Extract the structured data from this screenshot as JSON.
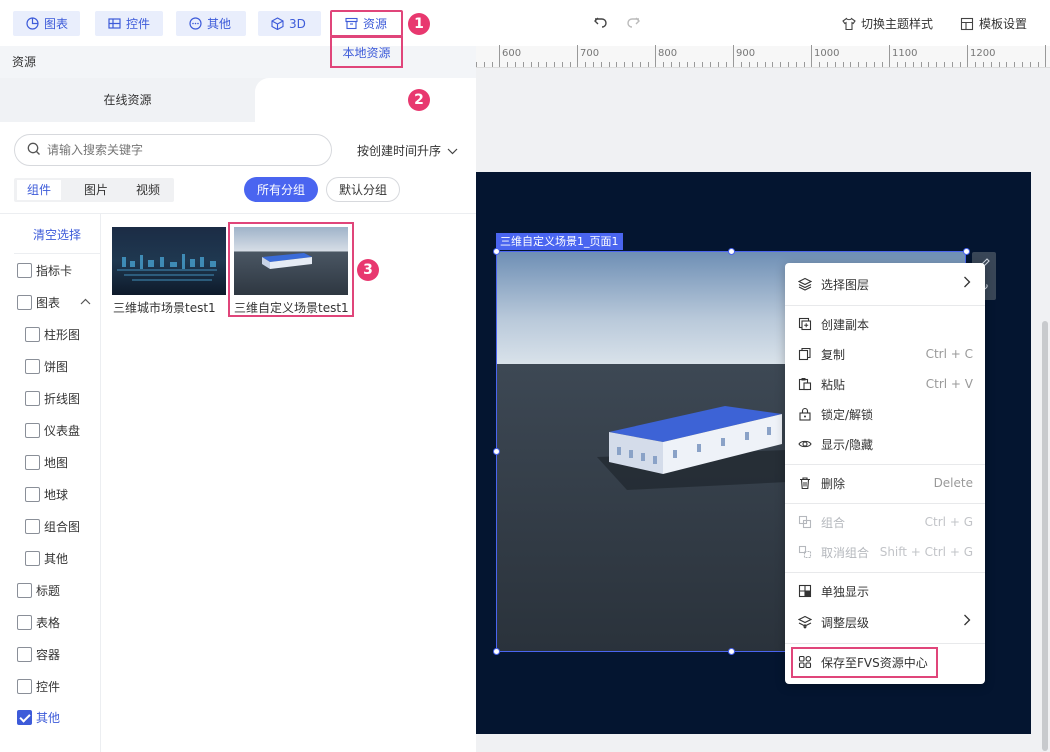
{
  "toolbar": {
    "buttons": [
      {
        "label": "图表",
        "icon": "chart-icon"
      },
      {
        "label": "控件",
        "icon": "widget-icon"
      },
      {
        "label": "其他",
        "icon": "more-icon"
      },
      {
        "label": "3D",
        "icon": "cube-icon"
      },
      {
        "label": "资源",
        "icon": "archive-icon"
      }
    ],
    "badges": [
      "1",
      "2",
      "3"
    ],
    "theme_label": "切换主题样式",
    "template_label": "模板设置"
  },
  "left": {
    "panel_title": "资源",
    "tab_online": "在线资源",
    "tab_local": "本地资源",
    "search_placeholder": "请输入搜索关键字",
    "sort_label": "按创建时间升序",
    "type_tabs": [
      "组件",
      "图片",
      "视频"
    ],
    "group_all": "所有分组",
    "group_default": "默认分组",
    "clear_label": "清空选择",
    "filters": [
      {
        "label": "指标卡",
        "checked": false
      },
      {
        "label": "图表",
        "checked": false
      },
      {
        "label": "柱形图",
        "checked": false
      },
      {
        "label": "饼图",
        "checked": false
      },
      {
        "label": "折线图",
        "checked": false
      },
      {
        "label": "仪表盘",
        "checked": false
      },
      {
        "label": "地图",
        "checked": false
      },
      {
        "label": "地球",
        "checked": false
      },
      {
        "label": "组合图",
        "checked": false
      },
      {
        "label": "其他",
        "checked": false
      },
      {
        "label": "标题",
        "checked": false
      },
      {
        "label": "表格",
        "checked": false
      },
      {
        "label": "容器",
        "checked": false
      },
      {
        "label": "控件",
        "checked": false
      },
      {
        "label": "其他",
        "checked": true
      }
    ],
    "thumbs": [
      {
        "label": "三维城市场景test1"
      },
      {
        "label": "三维自定义场景test1"
      }
    ]
  },
  "canvas": {
    "ruler": [
      "600",
      "700",
      "800",
      "900",
      "1000",
      "1100",
      "1200"
    ],
    "component_tag": "三维自定义场景1_页面1"
  },
  "menu": {
    "items": [
      {
        "label": "选择图层",
        "shortcut": "",
        "arrow": true,
        "disabled": false,
        "icon": "layers-icon"
      },
      {
        "label": "创建副本",
        "shortcut": "",
        "arrow": false,
        "disabled": false,
        "icon": "duplicate-icon"
      },
      {
        "label": "复制",
        "shortcut": "Ctrl + C",
        "arrow": false,
        "disabled": false,
        "icon": "copy-icon"
      },
      {
        "label": "粘贴",
        "shortcut": "Ctrl + V",
        "arrow": false,
        "disabled": false,
        "icon": "paste-icon"
      },
      {
        "label": "锁定/解锁",
        "shortcut": "",
        "arrow": false,
        "disabled": false,
        "icon": "lock-icon"
      },
      {
        "label": "显示/隐藏",
        "shortcut": "",
        "arrow": false,
        "disabled": false,
        "icon": "eye-icon"
      },
      {
        "label": "删除",
        "shortcut": "Delete",
        "arrow": false,
        "disabled": false,
        "icon": "trash-icon"
      },
      {
        "label": "组合",
        "shortcut": "Ctrl + G",
        "arrow": false,
        "disabled": true,
        "icon": "group-icon"
      },
      {
        "label": "取消组合",
        "shortcut": "Shift + Ctrl + G",
        "arrow": false,
        "disabled": true,
        "icon": "ungroup-icon"
      },
      {
        "label": "单独显示",
        "shortcut": "",
        "arrow": false,
        "disabled": false,
        "icon": "solo-icon"
      },
      {
        "label": "调整层级",
        "shortcut": "",
        "arrow": true,
        "disabled": false,
        "icon": "level-icon"
      },
      {
        "label": "保存至FVS资源中心",
        "shortcut": "",
        "arrow": false,
        "disabled": false,
        "icon": "save-resource-icon"
      }
    ]
  },
  "colors": {
    "accent": "#4a65f0",
    "highlight": "#e0457a",
    "stage": "#041530"
  }
}
